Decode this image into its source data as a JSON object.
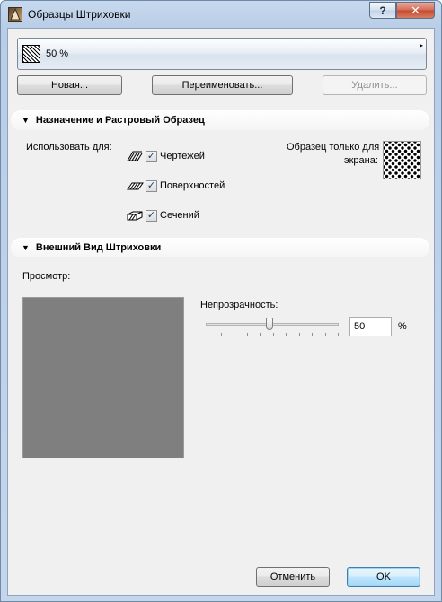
{
  "window": {
    "title": "Образцы Штриховки",
    "help_label": "?",
    "close_label": "✕"
  },
  "pattern": {
    "name": "50 %",
    "menu_arrow": "▸"
  },
  "actions": {
    "new_label": "Новая...",
    "rename_label": "Переименовать...",
    "delete_label": "Удалить..."
  },
  "section_usage": {
    "title": "Назначение и Растровый Образец",
    "use_for_label": "Использовать для:",
    "options": [
      {
        "label": "Чертежей",
        "checked": true,
        "icon": "drawing-fill-icon"
      },
      {
        "label": "Поверхностей",
        "checked": true,
        "icon": "surface-fill-icon"
      },
      {
        "label": "Сечений",
        "checked": true,
        "icon": "cut-fill-icon"
      }
    ],
    "screen_pattern_label_1": "Образец только для",
    "screen_pattern_label_2": "экрана:"
  },
  "section_appearance": {
    "title": "Внешний Вид Штриховки",
    "preview_label": "Просмотр:",
    "preview_color": "#7f7f7f",
    "opacity_label": "Непрозрачность:",
    "opacity_value": "50",
    "opacity_unit": "%",
    "opacity_fraction": 0.5
  },
  "footer": {
    "cancel_label": "Отменить",
    "ok_label": "OK"
  },
  "check_mark": "✓"
}
